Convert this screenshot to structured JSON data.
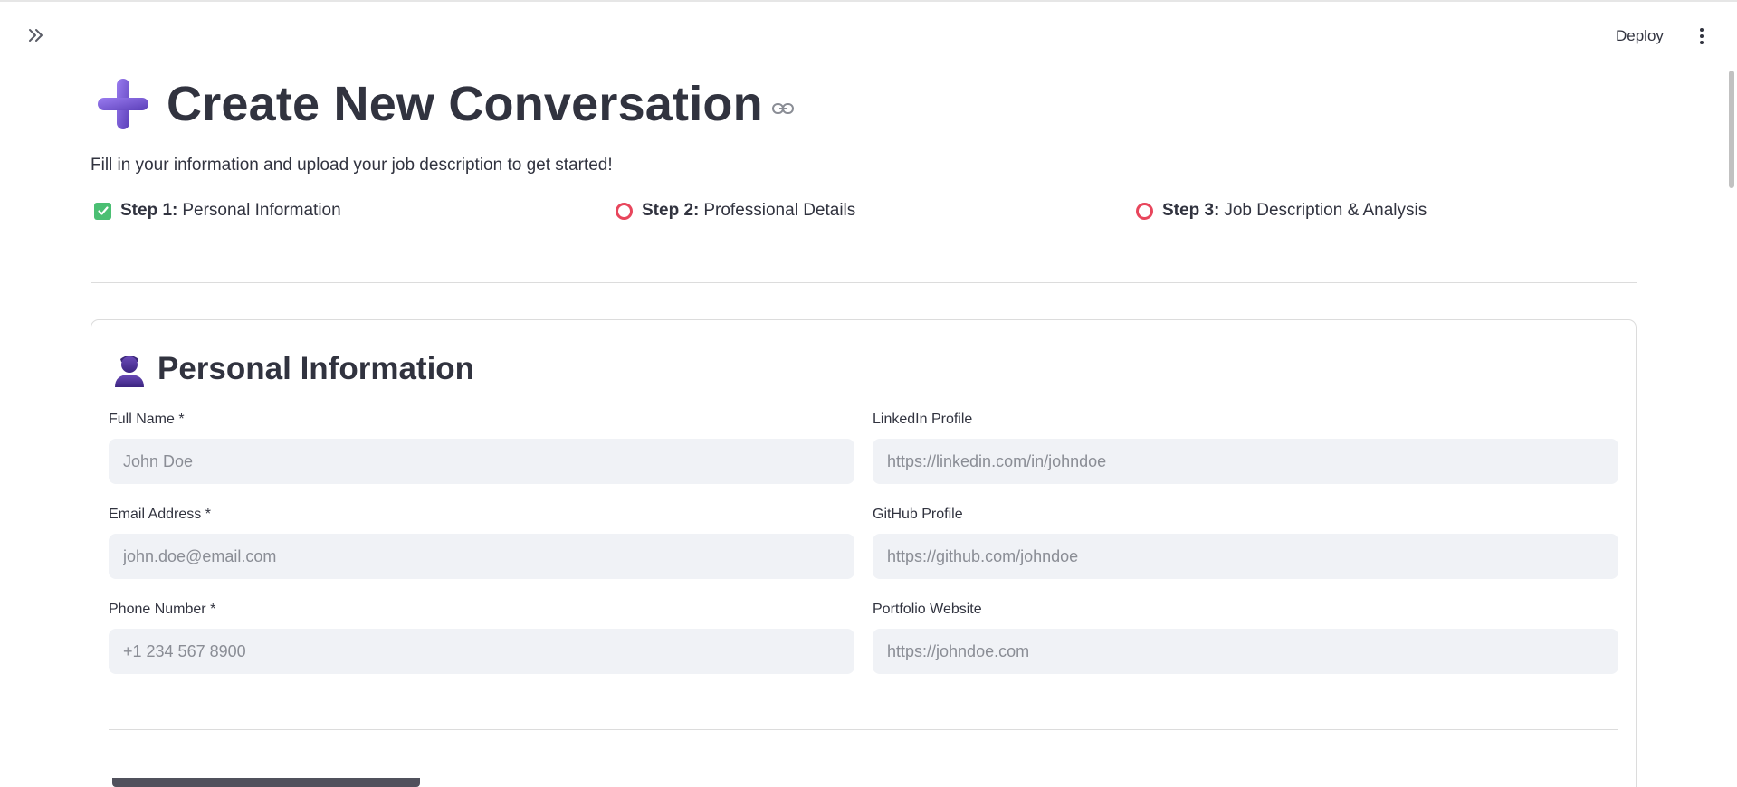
{
  "header": {
    "deploy_label": "Deploy",
    "menu_icon": "more-vertical-icon",
    "expand_icon": "chevrons-right-icon"
  },
  "page": {
    "title": "Create New Conversation",
    "title_icon": "heavy-plus-icon",
    "anchor_icon": "link-icon",
    "subtitle": "Fill in your information and upload your job description to get started!"
  },
  "steps": [
    {
      "icon": "check-icon",
      "step": "Step 1:",
      "label": "Personal Information",
      "status": "complete"
    },
    {
      "icon": "circle-icon",
      "step": "Step 2:",
      "label": "Professional Details",
      "status": "pending"
    },
    {
      "icon": "circle-icon",
      "step": "Step 3:",
      "label": "Job Description & Analysis",
      "status": "pending"
    }
  ],
  "personal_section": {
    "icon": "person-icon",
    "title": "Personal Information",
    "fields": {
      "full_name": {
        "label": "Full Name *",
        "value": "",
        "placeholder": "John Doe"
      },
      "email": {
        "label": "Email Address *",
        "value": "",
        "placeholder": "john.doe@email.com"
      },
      "phone": {
        "label": "Phone Number *",
        "value": "",
        "placeholder": "+1 234 567 8900"
      },
      "linkedin": {
        "label": "LinkedIn Profile",
        "value": "",
        "placeholder": "https://linkedin.com/in/johndoe"
      },
      "github": {
        "label": "GitHub Profile",
        "value": "",
        "placeholder": "https://github.com/johndoe"
      },
      "portfolio": {
        "label": "Portfolio Website",
        "value": "",
        "placeholder": "https://johndoe.com"
      }
    }
  },
  "colors": {
    "accent_purple": "#7b5cd6",
    "check_green": "#4bbf73",
    "pending_red": "#e8465c",
    "input_bg": "#f0f2f6",
    "text": "#31333f"
  }
}
